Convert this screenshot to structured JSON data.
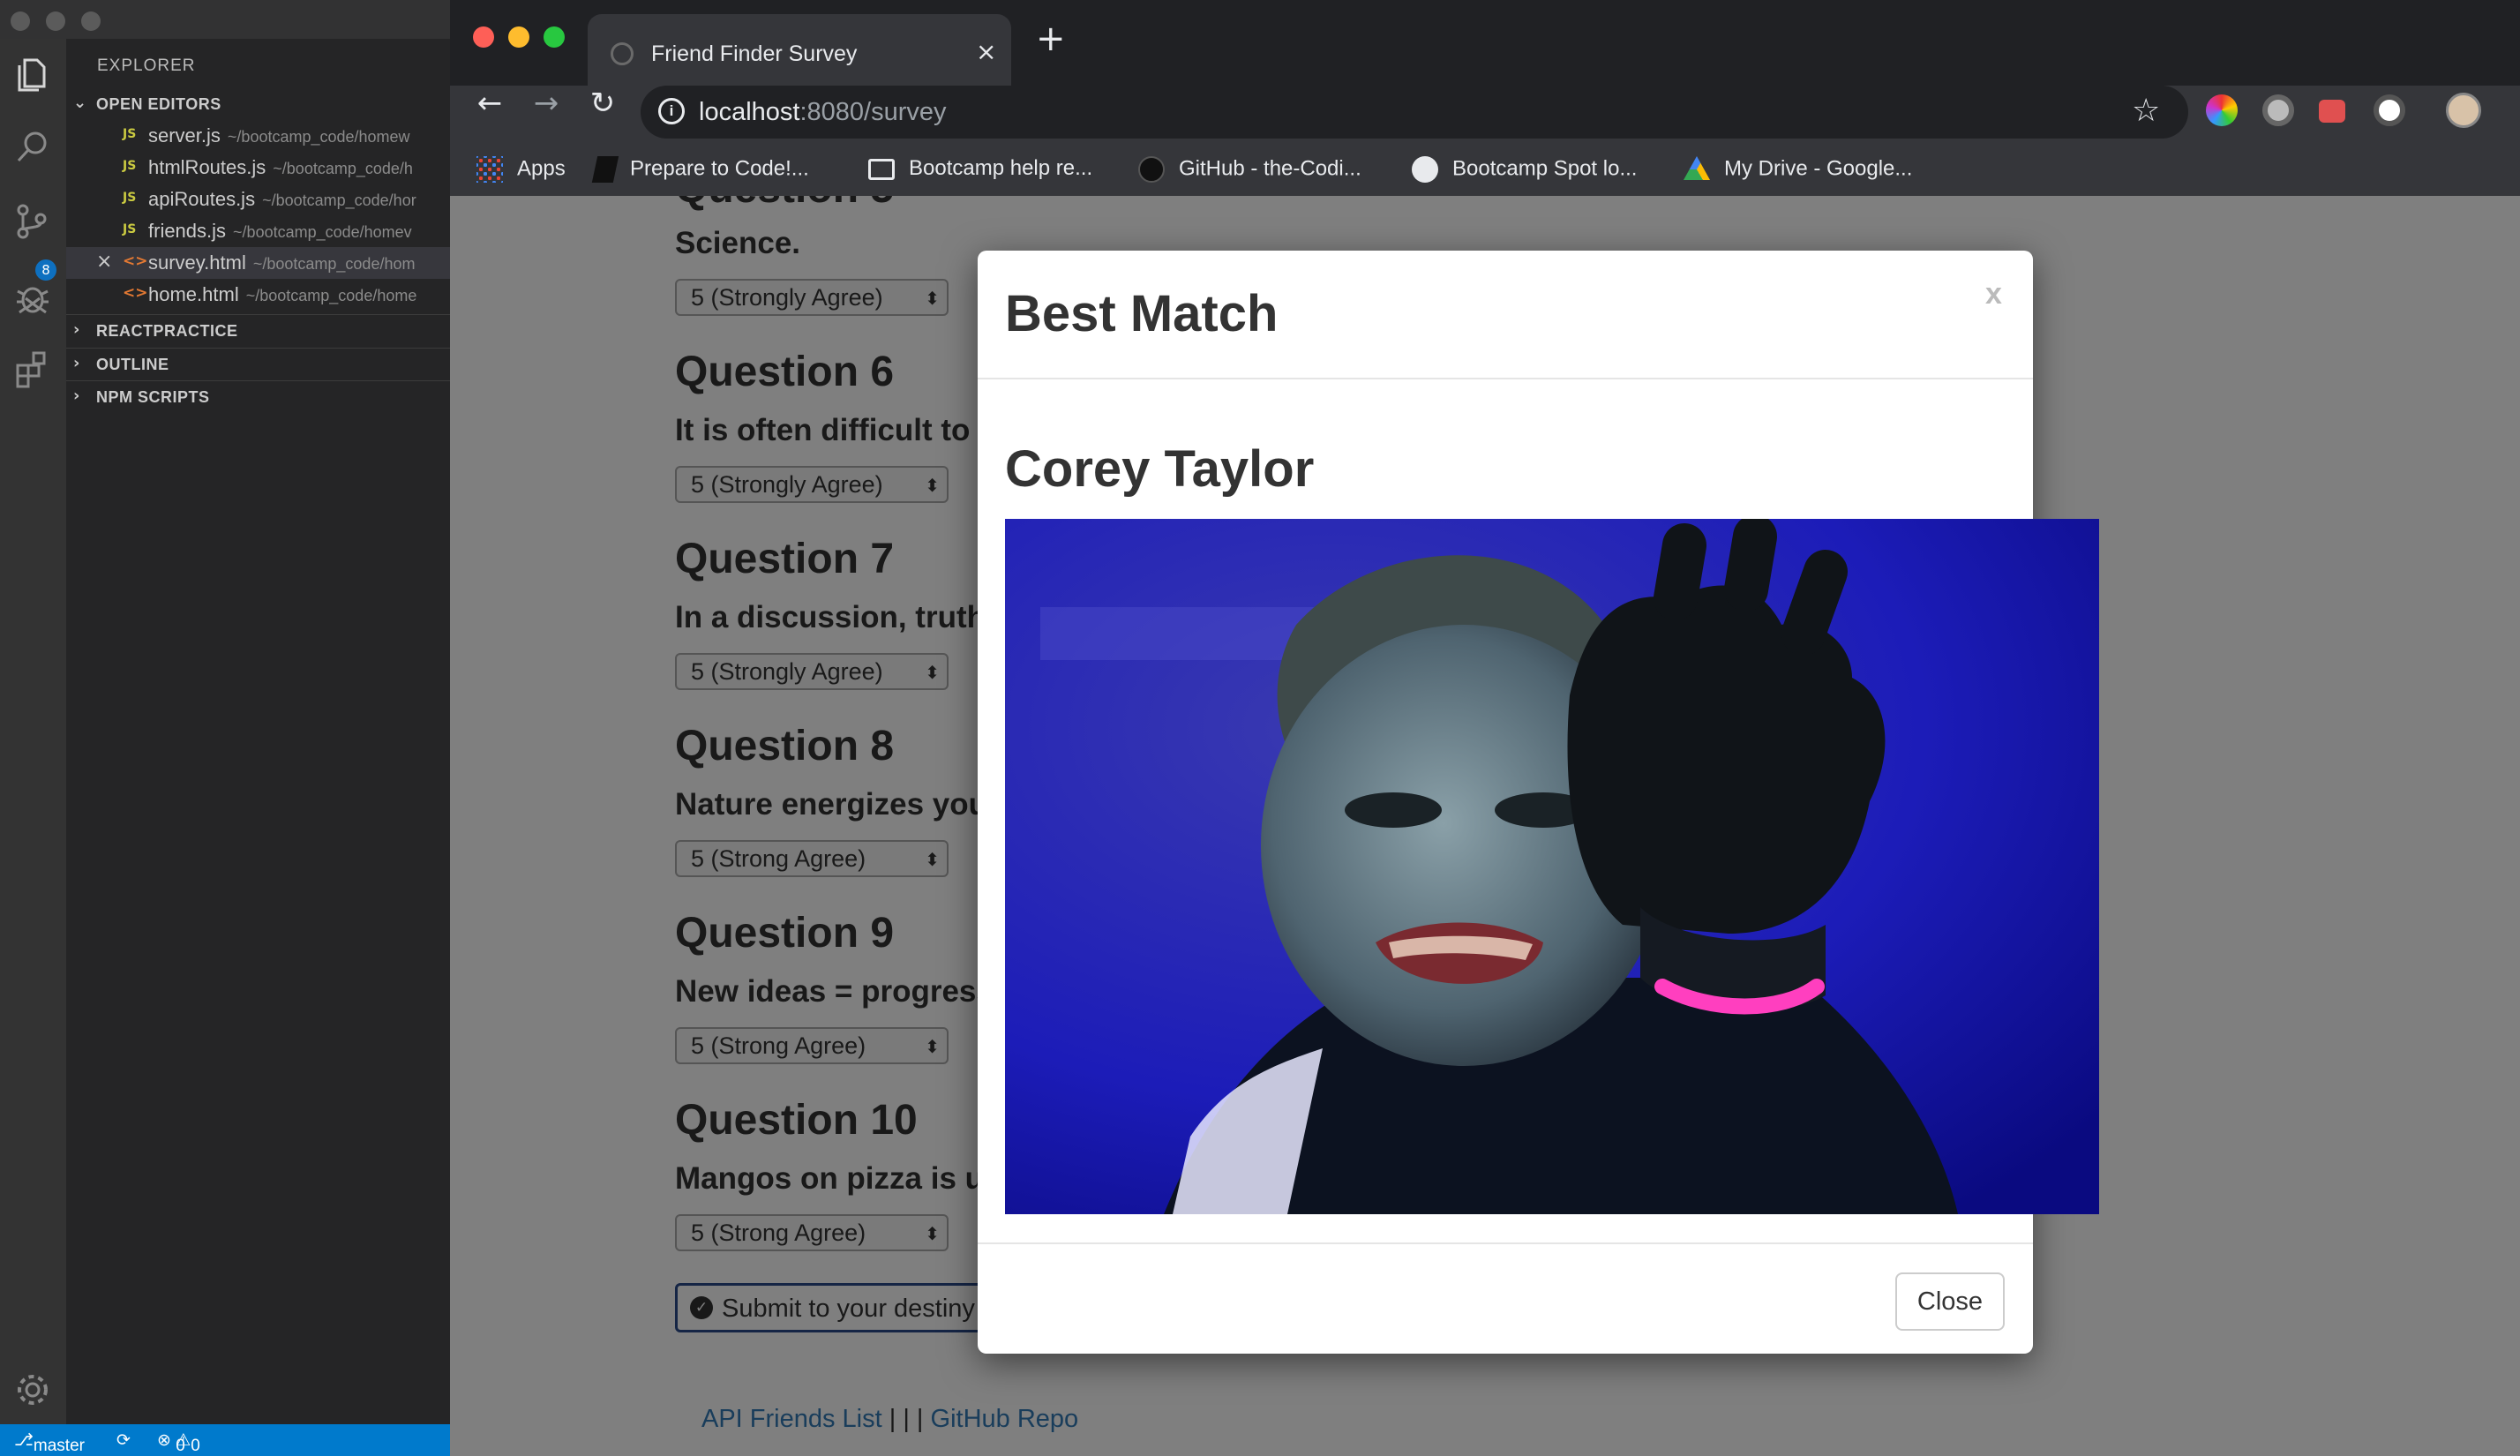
{
  "vscode": {
    "explorer_title": "EXPLORER",
    "open_editors_label": "OPEN EDITORS",
    "files": [
      {
        "type": "JS",
        "name": "server.js",
        "path": "~/bootcamp_code/homew"
      },
      {
        "type": "JS",
        "name": "htmlRoutes.js",
        "path": "~/bootcamp_code/h"
      },
      {
        "type": "JS",
        "name": "apiRoutes.js",
        "path": "~/bootcamp_code/hor"
      },
      {
        "type": "JS",
        "name": "friends.js",
        "path": "~/bootcamp_code/homev"
      },
      {
        "type": "<>",
        "name": "survey.html",
        "path": "~/bootcamp_code/hom"
      },
      {
        "type": "<>",
        "name": "home.html",
        "path": "~/bootcamp_code/home"
      }
    ],
    "sections": [
      "REACTPRACTICE",
      "OUTLINE",
      "NPM SCRIPTS"
    ],
    "scm_badge": "8",
    "status": {
      "branch": "master",
      "errors": "0",
      "warnings": "0"
    }
  },
  "browser": {
    "tab_title": "Friend Finder Survey",
    "url_host": "localhost",
    "url_rest": ":8080/survey",
    "bookmarks": [
      "Apps",
      "Prepare to Code!...",
      "Bootcamp help re...",
      "GitHub - the-Codi...",
      "Bootcamp Spot lo...",
      "My Drive - Google..."
    ]
  },
  "survey": {
    "prev_question_fragment": "Question 5",
    "prev_text": "Science.",
    "prev_answer": "5 (Strongly Agree)",
    "questions": [
      {
        "title": "Question 6",
        "text": "It is often difficult to",
        "answer": "5 (Strongly Agree)"
      },
      {
        "title": "Question 7",
        "text": "In a discussion, truth",
        "answer": "5 (Strongly Agree)"
      },
      {
        "title": "Question 8",
        "text": "Nature energizes you",
        "answer": "5 (Strong Agree)"
      },
      {
        "title": "Question 9",
        "text": "New ideas = progress",
        "answer": "5 (Strong Agree)"
      },
      {
        "title": "Question 10",
        "text": "Mangos on pizza is u",
        "answer": "5 (Strong Agree)"
      }
    ],
    "submit_label": "Submit to your destiny",
    "footer": {
      "link1": "API Friends List",
      "separator": " | | | ",
      "link2": "GitHub Repo"
    }
  },
  "modal": {
    "title": "Best Match",
    "close_x": "x",
    "match_name": "Corey Taylor",
    "close_button": "Close"
  }
}
